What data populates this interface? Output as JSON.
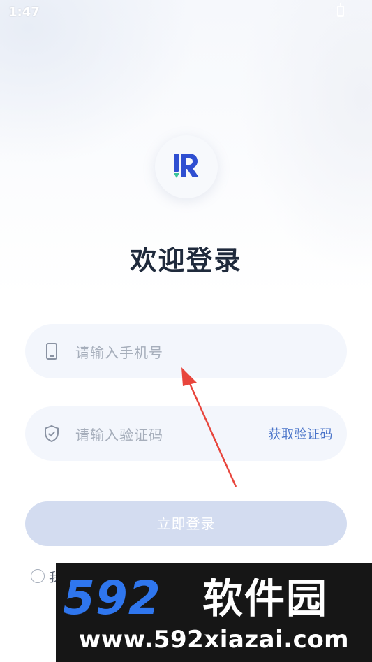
{
  "status_bar": {
    "time": "1:47"
  },
  "app": {
    "logo_letter": "R"
  },
  "title": "欢迎登录",
  "phone_field": {
    "icon": "phone-icon",
    "placeholder": "请输入手机号"
  },
  "code_field": {
    "icon": "shield-icon",
    "placeholder": "请输入验证码",
    "get_code_label": "获取验证码"
  },
  "login_button": {
    "label": "立即登录"
  },
  "agreement": {
    "text_visible": "我"
  },
  "watermark": {
    "brand_number": "592",
    "brand_name": "软件园",
    "url": "www.592xiazai.com"
  },
  "colors": {
    "accent": "#4a74c9",
    "title": "#1f2a3c",
    "button_disabled": "#d3dcf0",
    "field_bg": "#f3f6fc",
    "annotation_arrow": "#e8453c"
  }
}
